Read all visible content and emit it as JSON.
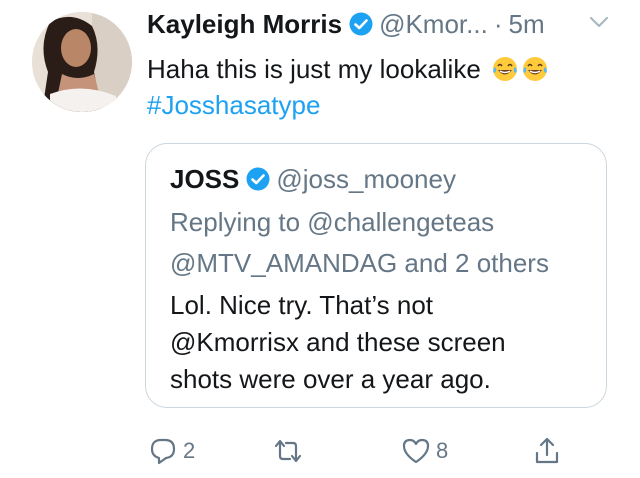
{
  "tweet": {
    "author_name": "Kayleigh Morris",
    "handle": "@Kmor...",
    "separator": "·",
    "time": "5m",
    "text": "Haha this is just my lookalike",
    "hashtag": "#Josshasatype",
    "emoji_name": "tears-of-joy-emoji"
  },
  "quoted": {
    "author_name": "JOSS",
    "handle": "@joss_mooney",
    "reply_line_1": "Replying to @challengeteas",
    "reply_line_2": "@MTV_AMANDAG and 2 others",
    "body_line_1": "Lol. Nice try. That’s not",
    "body_line_2": "@Kmorrisx and these screen",
    "body_line_3": "shots were over a year ago."
  },
  "actions": {
    "replies": "2",
    "likes": "8"
  },
  "colors": {
    "accent": "#1da1f2",
    "muted": "#657786",
    "border": "#ccd6dd",
    "text": "#14171a"
  }
}
